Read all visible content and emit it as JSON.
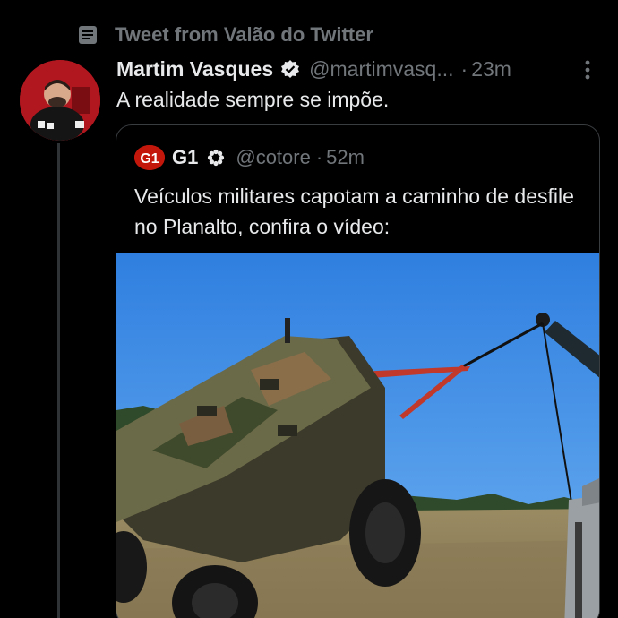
{
  "context": {
    "icon": "list-icon",
    "text": "Tweet from Valão do Twitter"
  },
  "tweet": {
    "display_name": "Martim Vasques",
    "handle": "@martimvasq...",
    "separator": "·",
    "time": "23m",
    "text": "A realidade sempre se impõe."
  },
  "quote": {
    "logo_text": "G1",
    "display_name": "G1",
    "handle": "@cotore",
    "separator": "·",
    "time": "52m",
    "text": "Veículos militares capotam a caminho de desfile no Planalto, confira o vídeo:"
  },
  "colors": {
    "background": "#000000",
    "text_primary": "#e7e9ea",
    "text_secondary": "#71767b",
    "g1_red": "#c4170c",
    "sky": "#3f8fe0"
  }
}
